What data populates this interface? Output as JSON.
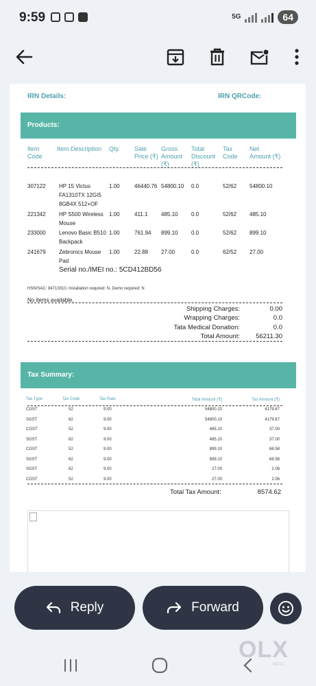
{
  "status": {
    "time": "9:59",
    "network": "5G",
    "battery": "64"
  },
  "appbar": {
    "icons": [
      "back-arrow-icon",
      "archive-icon",
      "delete-icon",
      "mark-unread-icon",
      "more-vert-icon"
    ]
  },
  "irn": {
    "details_label": "IRN Details:",
    "qr_label": "IRN QRCode:"
  },
  "products": {
    "title": "Products:",
    "headers": {
      "code": [
        "Item",
        "Code"
      ],
      "desc": [
        "Item Description"
      ],
      "qty": [
        "Qty."
      ],
      "price": [
        "Sale",
        "Price (₹)"
      ],
      "gross": [
        "Gross",
        "Amount",
        "(₹)"
      ],
      "discount": [
        "Total",
        "Discount",
        "(₹)"
      ],
      "tax": [
        "Tax",
        "Code"
      ],
      "net": [
        "Net",
        "Amount (₹)"
      ]
    },
    "rows": [
      {
        "code": "307122",
        "desc": [
          "HP 15 Victus",
          "FA1310TX 12GI5",
          "8GB4X 512+OF"
        ],
        "qty": "1.00",
        "price": "46440.76",
        "gross": "54800.10",
        "discount": "0.0",
        "tax": "52/62",
        "net": "54800.10"
      },
      {
        "code": "221342",
        "desc": [
          "HP S500 Wireless",
          "Mouse"
        ],
        "qty": "1.00",
        "price": "411.1",
        "gross": "485.10",
        "discount": "0.0",
        "tax": "52/62",
        "net": "485.10"
      },
      {
        "code": "233000",
        "desc": [
          "Lenovo Basic B510",
          "Backpack"
        ],
        "qty": "1.00",
        "price": "761.94",
        "gross": "899.10",
        "discount": "0.0",
        "tax": "52/62",
        "net": "899.10"
      },
      {
        "code": "241679",
        "desc": [
          "Zebronics Mouse",
          "Pad"
        ],
        "qty": "1.00",
        "price": "22.88",
        "gross": "27.00",
        "discount": "0.0",
        "tax": "62/52",
        "net": "27.00"
      }
    ],
    "serial": "Serial no./IMEI no.: 5CD412BD56",
    "hsn": "HSN/SAC: 84713010, Installation required: N, Demo required: N",
    "no_items": "No items available.",
    "charges": [
      {
        "label": "Shipping Charges:",
        "value": "0.00"
      },
      {
        "label": "Wrapping Charges:",
        "value": "0.0"
      },
      {
        "label": "Tata Medical Donation:",
        "value": "0.0"
      },
      {
        "label": "Total Amount:",
        "value": "56211.30"
      }
    ]
  },
  "tax_summary": {
    "title": "Tax Summary:",
    "headers": [
      "Tax Type",
      "Tax Code",
      "Tax Rate",
      "Total Amount (₹)",
      "Tax Amount (₹)"
    ],
    "rows": [
      [
        "CGST",
        "52",
        "9.00",
        "54800.10",
        "4179.67"
      ],
      [
        "SGST",
        "62",
        "9.00",
        "54800.10",
        "4179.67"
      ],
      [
        "CGST",
        "52",
        "9.00",
        "485.10",
        "37.00"
      ],
      [
        "SGST",
        "62",
        "9.00",
        "485.10",
        "37.00"
      ],
      [
        "CGST",
        "52",
        "9.00",
        "899.10",
        "68.58"
      ],
      [
        "SGST",
        "62",
        "9.00",
        "899.10",
        "68.58"
      ],
      [
        "SGST",
        "62",
        "9.00",
        "27.00",
        "2.06"
      ],
      [
        "CGST",
        "52",
        "9.00",
        "27.00",
        "2.06"
      ]
    ],
    "total_label": "Total Tax Amount:",
    "total_value": "8574.62"
  },
  "actions": {
    "reply": "Reply",
    "forward": "Forward"
  },
  "watermark": {
    "brand": "OLX",
    "sub": "INDIA"
  },
  "colors": {
    "accent": "#57b5a7",
    "header_text": "#4c9fb0",
    "pill": "#2f3544"
  }
}
